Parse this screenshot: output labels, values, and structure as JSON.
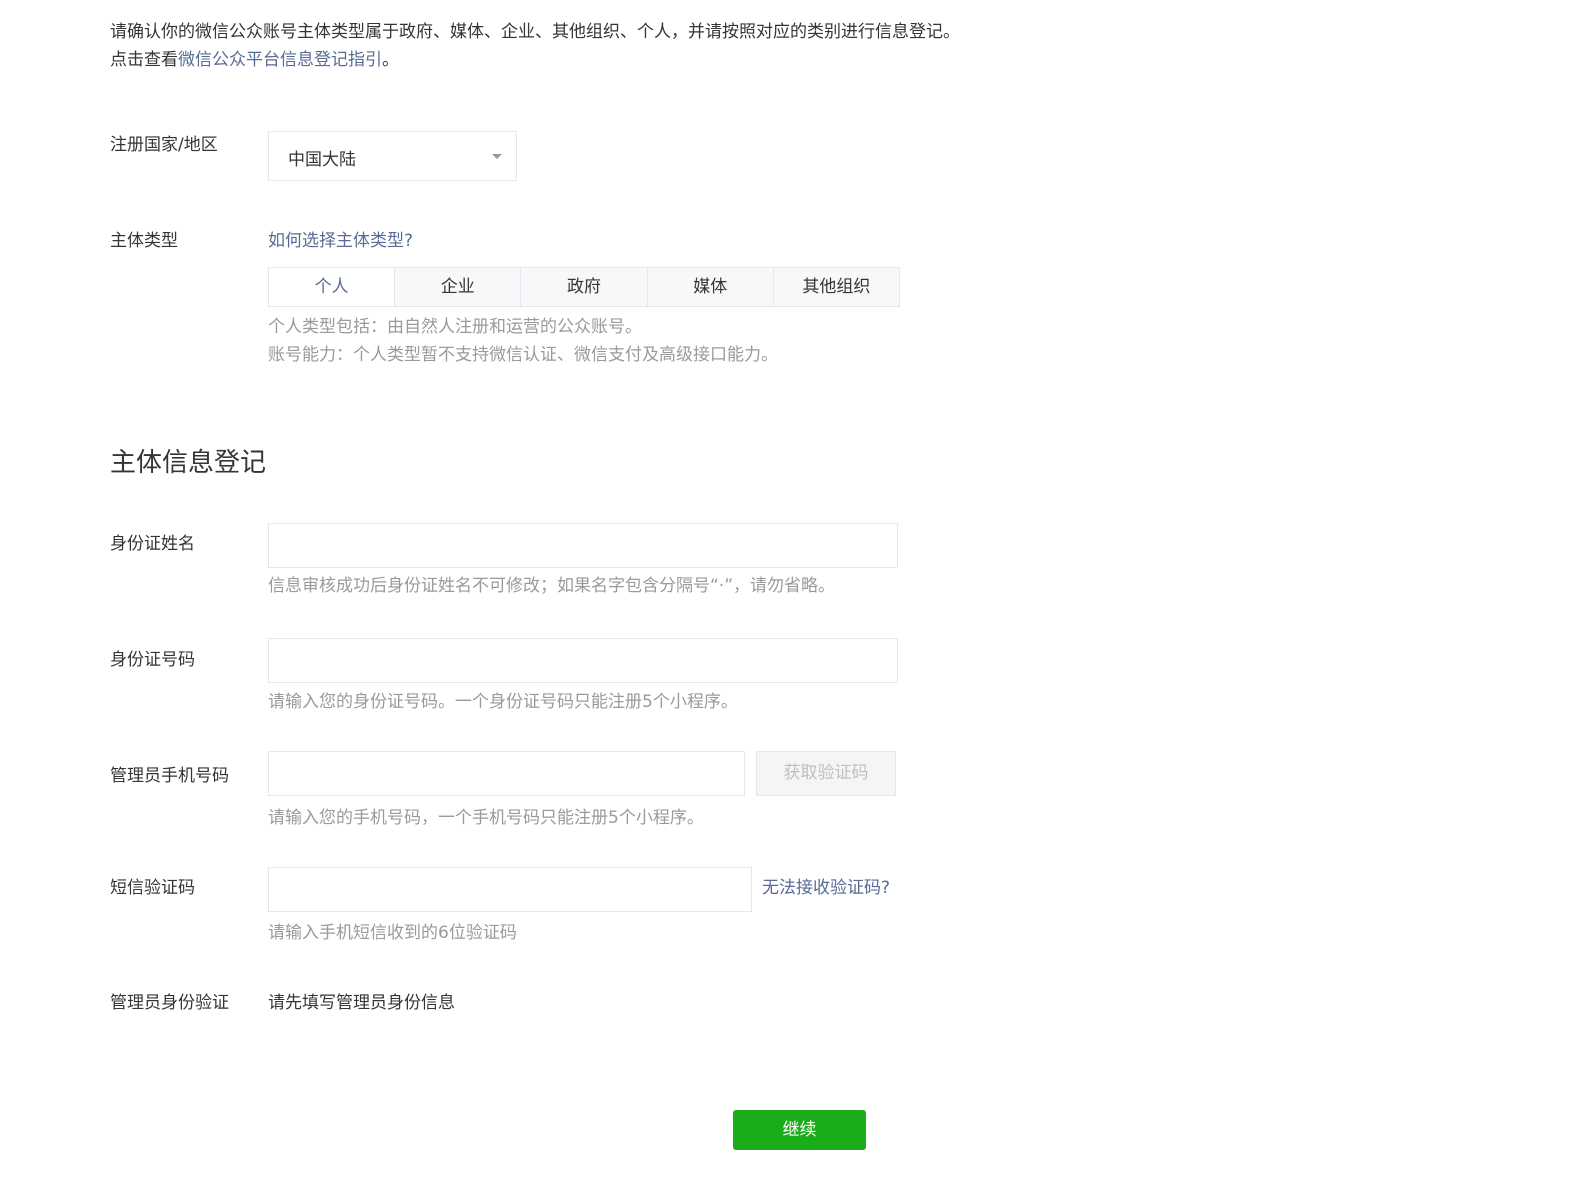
{
  "intro": {
    "line1": "请确认你的微信公众账号主体类型属于政府、媒体、企业、其他组织、个人，并请按照对应的类别进行信息登记。",
    "line2_prefix": "点击查看",
    "line2_link": "微信公众平台信息登记指引",
    "line2_suffix": "。"
  },
  "region": {
    "label": "注册国家/地区",
    "selected": "中国大陆"
  },
  "entity_type": {
    "label": "主体类型",
    "help_link": "如何选择主体类型?",
    "tabs": [
      "个人",
      "企业",
      "政府",
      "媒体",
      "其他组织"
    ],
    "active_tab": "个人",
    "desc1": "个人类型包括：由自然人注册和运营的公众账号。",
    "desc2": "账号能力：个人类型暂不支持微信认证、微信支付及高级接口能力。"
  },
  "section_title": "主体信息登记",
  "id_name": {
    "label": "身份证姓名",
    "value": "",
    "hint": "信息审核成功后身份证姓名不可修改；如果名字包含分隔号“·”，请勿省略。"
  },
  "id_number": {
    "label": "身份证号码",
    "value": "",
    "hint": "请输入您的身份证号码。一个身份证号码只能注册5个小程序。"
  },
  "admin_phone": {
    "label": "管理员手机号码",
    "value": "",
    "button": "获取验证码",
    "hint": "请输入您的手机号码，一个手机号码只能注册5个小程序。"
  },
  "sms_code": {
    "label": "短信验证码",
    "value": "",
    "link": "无法接收验证码?",
    "hint": "请输入手机短信收到的6位验证码"
  },
  "admin_verify": {
    "label": "管理员身份验证",
    "value": "请先填写管理员身份信息"
  },
  "continue_button": "继续",
  "colors": {
    "link": "#576b95",
    "primary_button": "#1aad19",
    "hint_text": "#9a9a9a",
    "border": "#e7e7eb"
  }
}
